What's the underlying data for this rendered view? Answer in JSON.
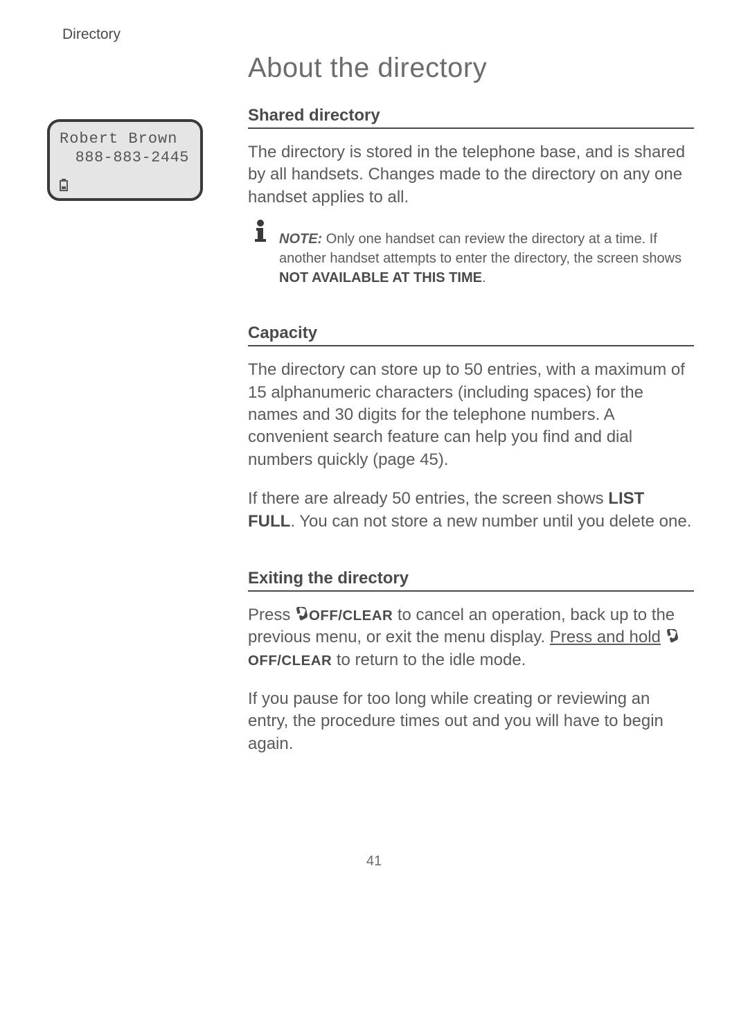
{
  "header": {
    "section": "Directory"
  },
  "lcd": {
    "name": "Robert Brown",
    "number": "888-883-2445"
  },
  "page": {
    "title": "About the directory",
    "number": "41"
  },
  "sections": {
    "shared": {
      "heading": "Shared directory",
      "body": "The directory is stored in the telephone base, and is shared by all handsets. Changes made to the directory on any one handset applies to all."
    },
    "note": {
      "label": "NOTE:",
      "text_before": " Only one handset can review the directory at a time. If another handset attempts to enter the directory, the screen shows ",
      "bold_text": "NOT AVAILABLE AT THIS TIME",
      "text_after": "."
    },
    "capacity": {
      "heading": "Capacity",
      "p1": "The directory can store up to 50 entries, with a maximum of 15 alphanumeric characters (including spaces) for the names and 30 digits for the telephone numbers. A convenient search feature can help you find and dial numbers quickly (page 45).",
      "p2_before": "If there are already 50 entries, the screen shows ",
      "p2_bold": "LIST FULL",
      "p2_after": ". You can not store a new number until you delete one."
    },
    "exiting": {
      "heading": "Exiting the directory",
      "p1_a": "Press ",
      "p1_button": "OFF/CLEAR",
      "p1_b": " to cancel an operation, back up to the previous menu, or exit the menu display. ",
      "p1_underline": "Press and hold",
      "p1_c": " ",
      "p1_button2": "OFF/CLEAR",
      "p1_d": " to return to the idle mode.",
      "p2": "If you pause for too long while creating or reviewing an entry, the procedure times out and you will have to begin again."
    }
  }
}
